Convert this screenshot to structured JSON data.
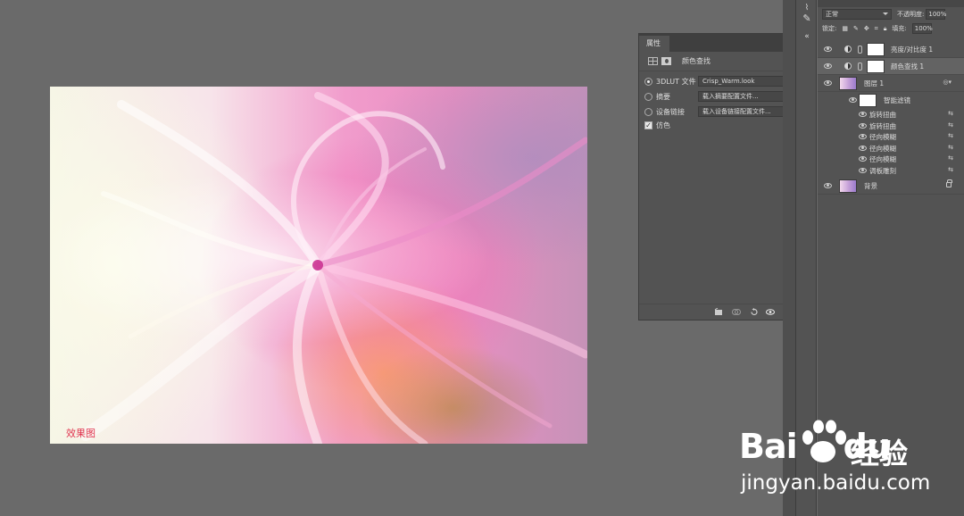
{
  "canvas": {
    "caption": "效果图"
  },
  "properties_panel": {
    "tab": "属性",
    "header_title": "颜色查找",
    "rows": [
      {
        "label": "3DLUT 文件",
        "control": "radio",
        "checked": true,
        "value": "Crisp_Warm.look"
      },
      {
        "label": "摘要",
        "control": "radio",
        "checked": false,
        "value": "载入摘要配置文件..."
      },
      {
        "label": "设备链接",
        "control": "radio",
        "checked": false,
        "value": "载入设备链接配置文件..."
      },
      {
        "label": "仿色",
        "control": "checkbox",
        "checked": true
      }
    ],
    "footer_icons": [
      "clip-to-layer-icon",
      "view-previous-icon",
      "reset-icon",
      "visibility-icon",
      "trash-icon"
    ]
  },
  "layers_panel": {
    "blend_mode": "正常",
    "opacity_label": "不透明度:",
    "opacity_value": "100%",
    "lock_label": "锁定:",
    "fill_label": "填充:",
    "fill_value": "100%",
    "layers": [
      {
        "name": "亮度/对比度 1",
        "type": "adjustment",
        "selected": false
      },
      {
        "name": "颜色查找 1",
        "type": "adjustment",
        "selected": true
      },
      {
        "name": "图层 1",
        "type": "smart-object",
        "selected": false
      },
      {
        "name": "智能滤镜",
        "type": "smart-filters",
        "selected": false
      },
      {
        "name": "背景",
        "type": "background",
        "selected": false,
        "locked": true
      }
    ],
    "filters": [
      "旋转扭曲",
      "旋转扭曲",
      "径向模糊",
      "径向模糊",
      "径向模糊",
      "调板雕刻"
    ]
  },
  "watermark": {
    "logo_text_1": "Bai",
    "logo_text_2": "du",
    "cn_text": "经验",
    "url": "jingyan.baidu.com"
  }
}
